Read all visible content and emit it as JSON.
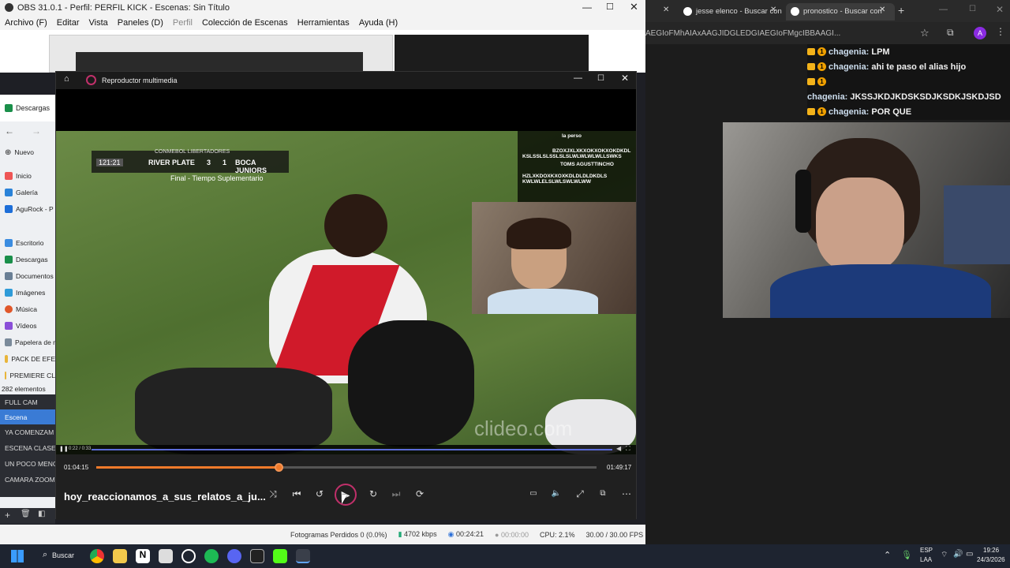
{
  "obs": {
    "title": "OBS 31.0.1 - Perfil: PERFIL KICK - Escenas: Sin Título",
    "menu": [
      "Archivo (F)",
      "Editar",
      "Vista",
      "Paneles (D)",
      "Perfil",
      "Colección de Escenas",
      "Herramientas",
      "Ayuda (H)"
    ],
    "sidebar": {
      "downloads_header": "Descargas",
      "new_label": "Nuevo",
      "items": [
        "Inicio",
        "Galería",
        "AguRock - P",
        "Escritorio",
        "Descargas",
        "Documentos",
        "Imágenes",
        "Música",
        "Vídeos",
        "Papelera de r",
        "PACK DE EFE",
        "PREMIERE CL"
      ],
      "count": "282 elementos"
    },
    "scenes": [
      "FULL CAM",
      "Escena",
      "YA COMENZAM",
      "ESCENA CLASE",
      "UN POCO MENO",
      "CAMARA ZOOM"
    ],
    "status": {
      "dropped": "Fotogramas Perdidos 0 (0.0%)",
      "bitrate": "4702 kbps",
      "live_time": "00:24:21",
      "rec_time": "00:00:00",
      "cpu": "CPU: 2.1%",
      "fps": "30.00 / 30.00 FPS"
    }
  },
  "player": {
    "title": "Reproductor multimedia",
    "filename": "hoy_reaccionamos_a_sus_relatos_a_ju...",
    "current_time": "01:04:15",
    "total_time": "01:49:17",
    "progress": 0.364,
    "inner_progress_label": "0:22 / 0:33",
    "score": {
      "competition": "CONMEBOL LIBERTADORES",
      "clock": "121:21",
      "home": "RIVER PLATE",
      "home_score": "3",
      "away_score": "1",
      "away": "BOCA JUNIORS",
      "phase": "Final - Tiempo Suplementario"
    },
    "watermark": "clideo.com",
    "overlay_chat": [
      "la perso",
      "BZOXJXLXKXOKXOKXOKDKDL",
      "KSLSSLSLSSLSLSLWLWLWLWLLSWKS",
      "TOMS AGUSTTINCHO",
      "HZLXKDOXKXOXKDLDLDLDKDLS",
      "KWLWLELSLWLSWLWLWW"
    ]
  },
  "browser": {
    "tabs": [
      "jesse elenco - Buscar con",
      "pronostico - Buscar con"
    ],
    "url_fragment": "AEGIoFMhAIAxAAGJIDGLEDGIAEGIoFMgcIBBAAGI...",
    "avatar": "A",
    "chat": [
      {
        "user": "chagenia:",
        "msg": "LPM"
      },
      {
        "user": "chagenia:",
        "msg": "ahi te paso el alias hijo"
      },
      {
        "user": "chagenia:",
        "msg": "JKSSJKDJKDSKSDJKSDKJSKDJSD"
      },
      {
        "user": "chagenia:",
        "msg": "POR QUE"
      }
    ]
  },
  "taskbar": {
    "search": "Buscar",
    "lang_top": "ESP",
    "lang_bottom": "LAA",
    "time": "19:26",
    "date": "24/3/2026"
  },
  "colors": {
    "progress": "#f07a2a",
    "play_ring": "#c0306a",
    "accent": "#8a2be2"
  }
}
